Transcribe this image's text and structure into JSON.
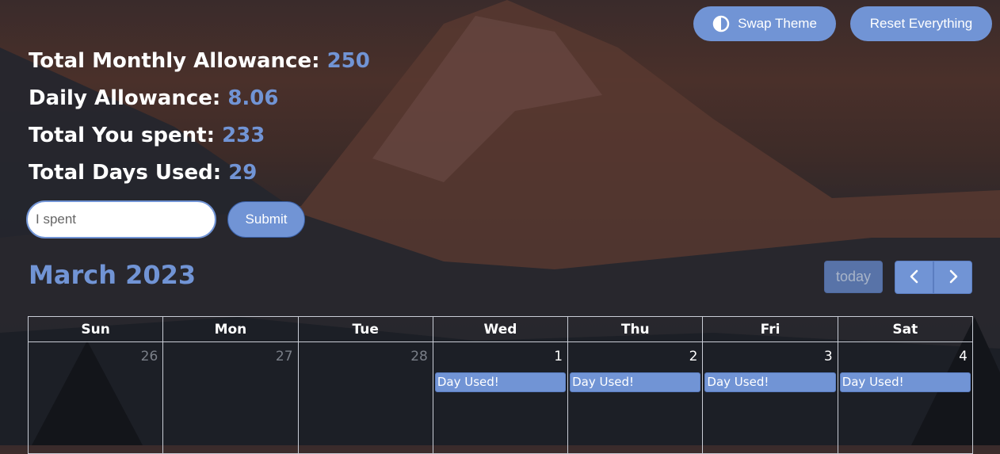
{
  "header": {
    "swap_theme_label": "Swap Theme",
    "reset_label": "Reset Everything"
  },
  "stats": {
    "monthly_label": "Total Monthly Allowance:",
    "monthly_value": "250",
    "daily_label": "Daily Allowance:",
    "daily_value": "8.06",
    "spent_label": "Total You spent:",
    "spent_value": "233",
    "days_label": "Total Days Used:",
    "days_value": "29"
  },
  "form": {
    "input_placeholder": "I spent",
    "input_value": "",
    "submit_label": "Submit"
  },
  "calendar": {
    "title": "March 2023",
    "today_label": "today",
    "prev_icon": "chevron-left-icon",
    "next_icon": "chevron-right-icon",
    "weekdays": [
      "Sun",
      "Mon",
      "Tue",
      "Wed",
      "Thu",
      "Fri",
      "Sat"
    ],
    "week1": [
      {
        "day": "26",
        "event": ""
      },
      {
        "day": "27",
        "event": ""
      },
      {
        "day": "28",
        "event": ""
      },
      {
        "day": "1",
        "event": "Day Used!"
      },
      {
        "day": "2",
        "event": "Day Used!"
      },
      {
        "day": "3",
        "event": "Day Used!"
      },
      {
        "day": "4",
        "event": "Day Used!"
      }
    ]
  },
  "colors": {
    "accent": "#7194d5",
    "border": "#c9cdd6",
    "muted_day": "#7a7f88"
  }
}
